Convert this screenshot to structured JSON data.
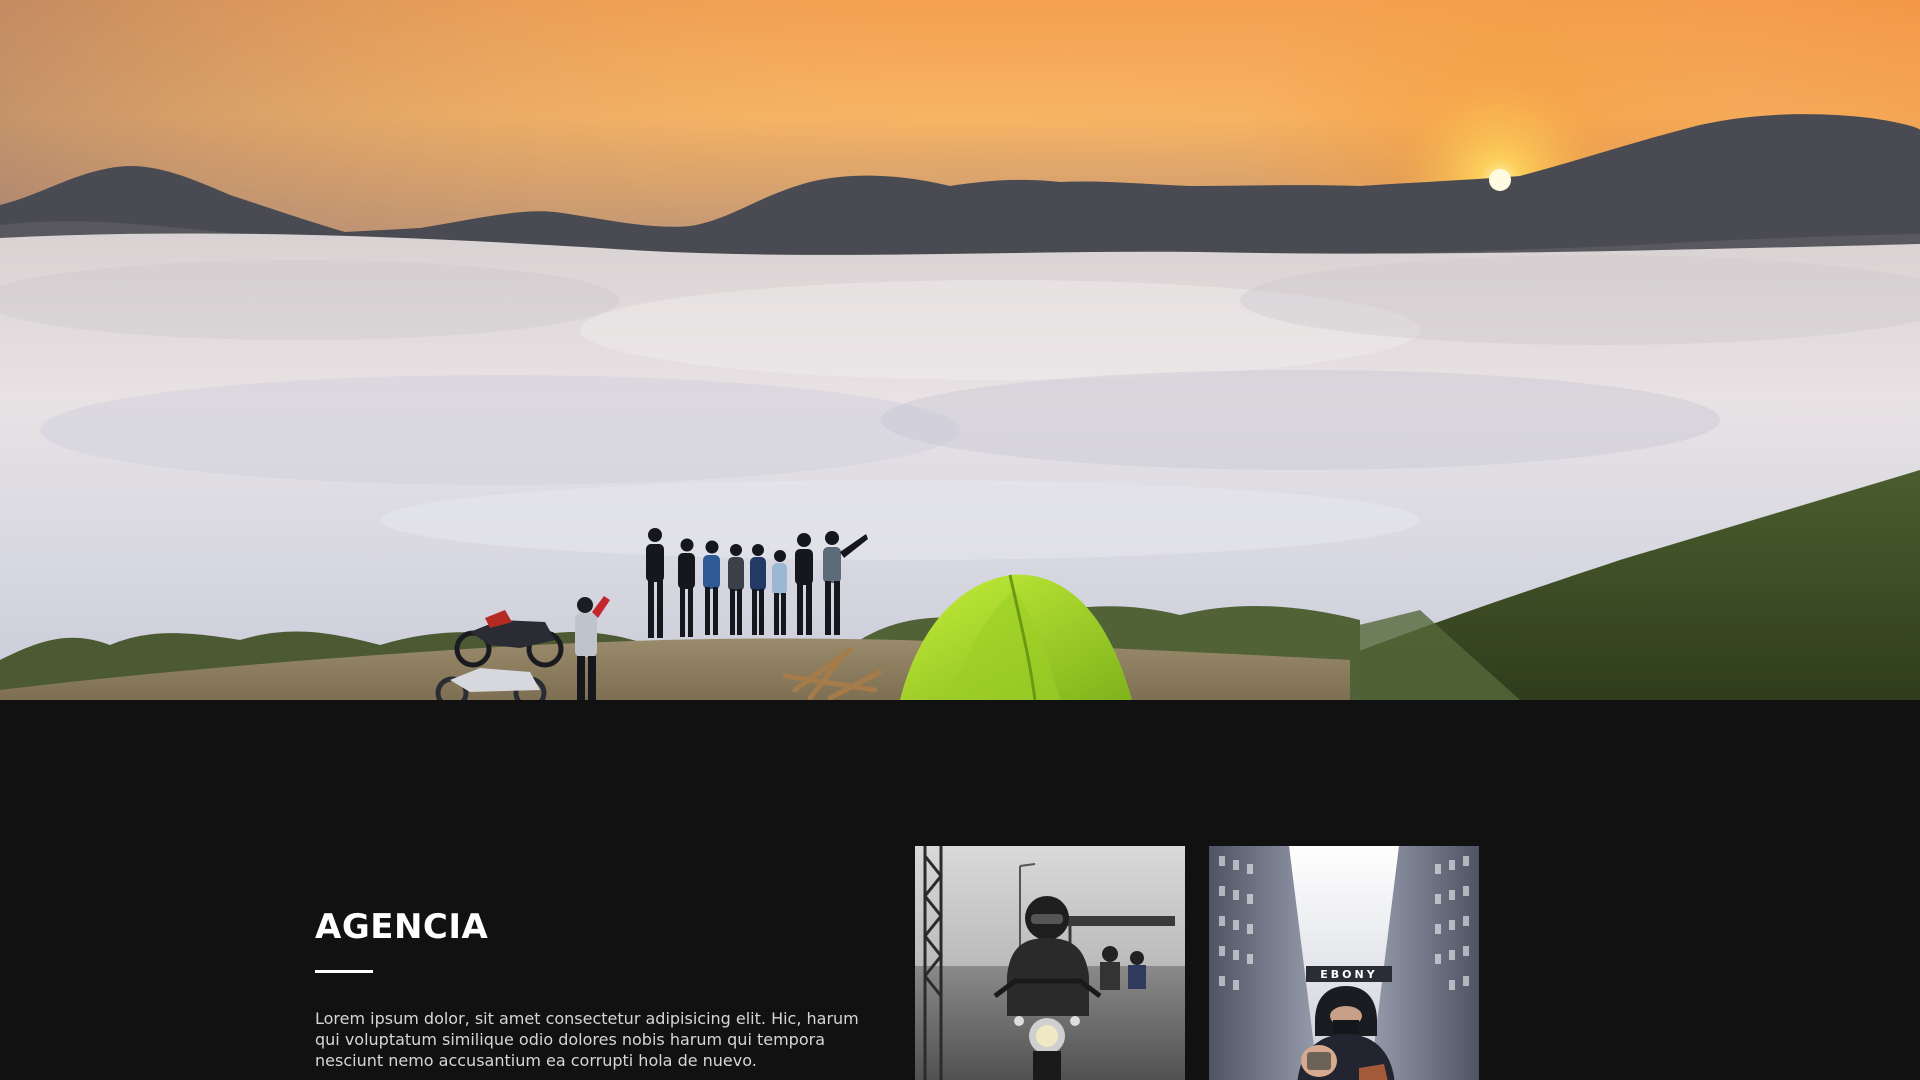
{
  "hero": {
    "image": "sunrise-above-clouds-camping-photo"
  },
  "agency": {
    "title": "AGENCIA",
    "description": "Lorem ipsum dolor, sit amet consectetur adipisicing elit. Hic, harum qui voluptatum similique odio dolores nobis harum qui tempora nesciunt nemo accusantium ea corrupti hola de nuevo.",
    "gallery": [
      {
        "image": "motorcycle-rider-rain-photo"
      },
      {
        "image": "person-in-hood-building-alley-photo",
        "sign_text": "EBONY"
      }
    ]
  },
  "colors": {
    "background": "#111111",
    "title": "#ffffff",
    "text": "#d6d6d6"
  }
}
